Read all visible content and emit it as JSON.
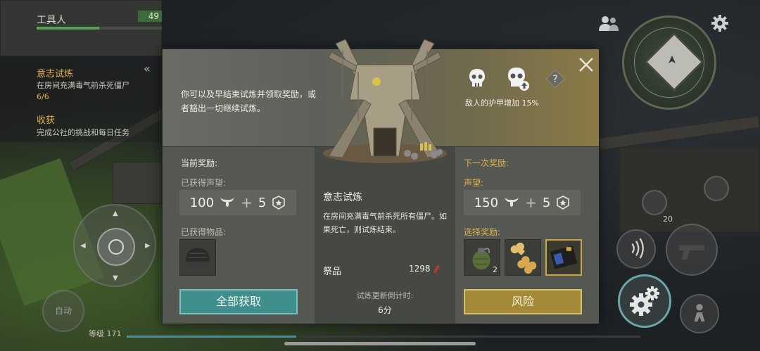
{
  "player": {
    "name": "工具人",
    "xp_value": "49",
    "xp_fraction": 0.5,
    "level_label": "等级 171",
    "level_fraction": 0.33
  },
  "quests": [
    {
      "title": "意志试炼",
      "desc": "在房间充满毒气前杀死僵尸",
      "progress": "6/6"
    },
    {
      "title": "收获",
      "desc": "完成公社的挑战和每日任务"
    }
  ],
  "hud": {
    "auto_label": "自动",
    "ammo_count": "20",
    "icons": [
      "people-icon",
      "settings-icon",
      "minimap",
      "joystick",
      "sound-icon",
      "gun-icon",
      "gear-icon",
      "character-icon"
    ]
  },
  "modal": {
    "intro": "你可以及早结束试炼并领取奖励，或者豁出一切继续试炼。",
    "risk_text": "敌人的护甲增加 15%",
    "help_symbol": "?",
    "current": {
      "heading": "当前奖励:",
      "rep_label": "已获得声望:",
      "rep_value": "100",
      "shield_value": "5",
      "items_label": "已获得物品:",
      "items": [
        {
          "icon": "helmet-icon"
        }
      ],
      "button": "全部获取"
    },
    "trial": {
      "title": "意志试炼",
      "desc": "在房间充满毒气前杀死所有僵尸。如果死亡，则试炼结束。",
      "offering_label": "祭品",
      "offering_value": "1298",
      "refresh_label": "试炼更新倒计时:",
      "refresh_value": "6分"
    },
    "next": {
      "heading": "下一次奖励:",
      "rep_label": "声望:",
      "rep_value": "150",
      "shield_value": "5",
      "choose_label": "选择奖励:",
      "choices": [
        {
          "icon": "grenade-icon",
          "count": "2"
        },
        {
          "icon": "bone-icon",
          "count": ""
        },
        {
          "icon": "id-card-icon",
          "count": "",
          "selected": true
        }
      ],
      "button": "风险"
    }
  },
  "colors": {
    "collect": "#3f8f8c",
    "risk": "#a48a38",
    "quest_title": "#e0b24a"
  }
}
